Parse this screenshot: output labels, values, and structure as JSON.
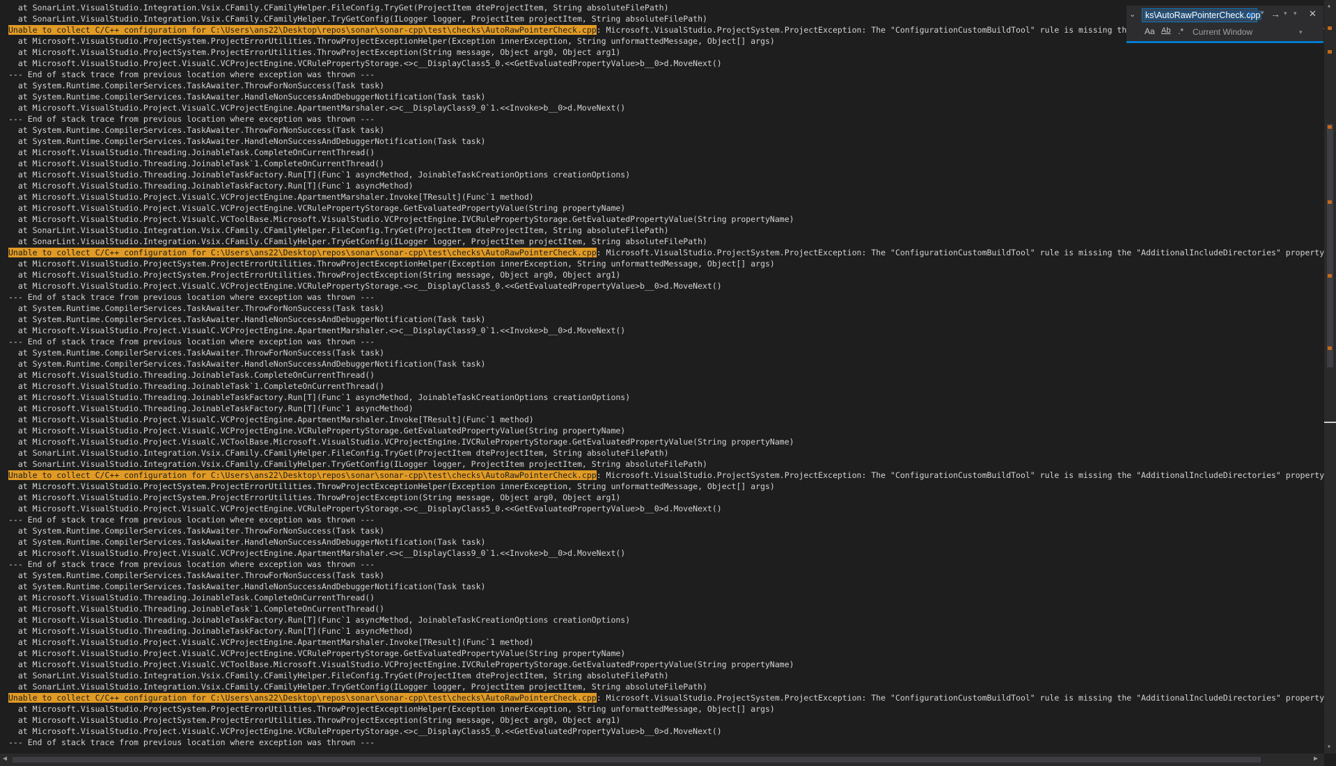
{
  "log": {
    "lines": [
      {
        "text": "  at SonarLint.VisualStudio.Integration.Vsix.CFamily.CFamilyHelper.FileConfig.TryGet(ProjectItem dteProjectItem, String absoluteFilePath)"
      },
      {
        "text": "  at SonarLint.VisualStudio.Integration.Vsix.CFamily.CFamilyHelper.TryGetConfig(ILogger logger, ProjectItem projectItem, String absoluteFilePath)"
      },
      {
        "hl": "Unable to collect C/C++ configuration for C:\\Users\\ans22\\Desktop\\repos\\sonar\\sonar-cpp\\test\\checks\\AutoRawPointerCheck.cpp",
        "text": ": Microsoft.VisualStudio.ProjectSystem.ProjectException: The \"ConfigurationCustomBuildTool\" rule is missing the \"AdditionalIncludeDirectories\" property."
      },
      {
        "text": "  at Microsoft.VisualStudio.ProjectSystem.ProjectErrorUtilities.ThrowProjectExceptionHelper(Exception innerException, String unformattedMessage, Object[] args)"
      },
      {
        "text": "  at Microsoft.VisualStudio.ProjectSystem.ProjectErrorUtilities.ThrowProjectException(String message, Object arg0, Object arg1)"
      },
      {
        "text": "  at Microsoft.VisualStudio.Project.VisualC.VCProjectEngine.VCRulePropertyStorage.<>c__DisplayClass5_0.<<GetEvaluatedPropertyValue>b__0>d.MoveNext()"
      },
      {
        "text": "--- End of stack trace from previous location where exception was thrown ---"
      },
      {
        "text": "  at System.Runtime.CompilerServices.TaskAwaiter.ThrowForNonSuccess(Task task)"
      },
      {
        "text": "  at System.Runtime.CompilerServices.TaskAwaiter.HandleNonSuccessAndDebuggerNotification(Task task)"
      },
      {
        "text": "  at Microsoft.VisualStudio.Project.VisualC.VCProjectEngine.ApartmentMarshaler.<>c__DisplayClass9_0`1.<<Invoke>b__0>d.MoveNext()"
      },
      {
        "text": "--- End of stack trace from previous location where exception was thrown ---"
      },
      {
        "text": "  at System.Runtime.CompilerServices.TaskAwaiter.ThrowForNonSuccess(Task task)"
      },
      {
        "text": "  at System.Runtime.CompilerServices.TaskAwaiter.HandleNonSuccessAndDebuggerNotification(Task task)"
      },
      {
        "text": "  at Microsoft.VisualStudio.Threading.JoinableTask.CompleteOnCurrentThread()"
      },
      {
        "text": "  at Microsoft.VisualStudio.Threading.JoinableTask`1.CompleteOnCurrentThread()"
      },
      {
        "text": "  at Microsoft.VisualStudio.Threading.JoinableTaskFactory.Run[T](Func`1 asyncMethod, JoinableTaskCreationOptions creationOptions)"
      },
      {
        "text": "  at Microsoft.VisualStudio.Threading.JoinableTaskFactory.Run[T](Func`1 asyncMethod)"
      },
      {
        "text": "  at Microsoft.VisualStudio.Project.VisualC.VCProjectEngine.ApartmentMarshaler.Invoke[TResult](Func`1 method)"
      },
      {
        "text": "  at Microsoft.VisualStudio.Project.VisualC.VCProjectEngine.VCRulePropertyStorage.GetEvaluatedPropertyValue(String propertyName)"
      },
      {
        "text": "  at Microsoft.VisualStudio.Project.VisualC.VCToolBase.Microsoft.VisualStudio.VCProjectEngine.IVCRulePropertyStorage.GetEvaluatedPropertyValue(String propertyName)"
      },
      {
        "text": "  at SonarLint.VisualStudio.Integration.Vsix.CFamily.CFamilyHelper.FileConfig.TryGet(ProjectItem dteProjectItem, String absoluteFilePath)"
      },
      {
        "text": "  at SonarLint.VisualStudio.Integration.Vsix.CFamily.CFamilyHelper.TryGetConfig(ILogger logger, ProjectItem projectItem, String absoluteFilePath)"
      },
      {
        "hl": "Unable to collect C/C++ configuration for C:\\Users\\ans22\\Desktop\\repos\\sonar\\sonar-cpp\\test\\checks\\AutoRawPointerCheck.cpp",
        "text": ": Microsoft.VisualStudio.ProjectSystem.ProjectException: The \"ConfigurationCustomBuildTool\" rule is missing the \"AdditionalIncludeDirectories\" property."
      },
      {
        "text": "  at Microsoft.VisualStudio.ProjectSystem.ProjectErrorUtilities.ThrowProjectExceptionHelper(Exception innerException, String unformattedMessage, Object[] args)"
      },
      {
        "text": "  at Microsoft.VisualStudio.ProjectSystem.ProjectErrorUtilities.ThrowProjectException(String message, Object arg0, Object arg1)"
      },
      {
        "text": "  at Microsoft.VisualStudio.Project.VisualC.VCProjectEngine.VCRulePropertyStorage.<>c__DisplayClass5_0.<<GetEvaluatedPropertyValue>b__0>d.MoveNext()"
      },
      {
        "text": "--- End of stack trace from previous location where exception was thrown ---"
      },
      {
        "text": "  at System.Runtime.CompilerServices.TaskAwaiter.ThrowForNonSuccess(Task task)"
      },
      {
        "text": "  at System.Runtime.CompilerServices.TaskAwaiter.HandleNonSuccessAndDebuggerNotification(Task task)"
      },
      {
        "text": "  at Microsoft.VisualStudio.Project.VisualC.VCProjectEngine.ApartmentMarshaler.<>c__DisplayClass9_0`1.<<Invoke>b__0>d.MoveNext()"
      },
      {
        "text": "--- End of stack trace from previous location where exception was thrown ---"
      },
      {
        "text": "  at System.Runtime.CompilerServices.TaskAwaiter.ThrowForNonSuccess(Task task)"
      },
      {
        "text": "  at System.Runtime.CompilerServices.TaskAwaiter.HandleNonSuccessAndDebuggerNotification(Task task)"
      },
      {
        "text": "  at Microsoft.VisualStudio.Threading.JoinableTask.CompleteOnCurrentThread()"
      },
      {
        "text": "  at Microsoft.VisualStudio.Threading.JoinableTask`1.CompleteOnCurrentThread()"
      },
      {
        "text": "  at Microsoft.VisualStudio.Threading.JoinableTaskFactory.Run[T](Func`1 asyncMethod, JoinableTaskCreationOptions creationOptions)"
      },
      {
        "text": "  at Microsoft.VisualStudio.Threading.JoinableTaskFactory.Run[T](Func`1 asyncMethod)"
      },
      {
        "text": "  at Microsoft.VisualStudio.Project.VisualC.VCProjectEngine.ApartmentMarshaler.Invoke[TResult](Func`1 method)"
      },
      {
        "text": "  at Microsoft.VisualStudio.Project.VisualC.VCProjectEngine.VCRulePropertyStorage.GetEvaluatedPropertyValue(String propertyName)"
      },
      {
        "text": "  at Microsoft.VisualStudio.Project.VisualC.VCToolBase.Microsoft.VisualStudio.VCProjectEngine.IVCRulePropertyStorage.GetEvaluatedPropertyValue(String propertyName)"
      },
      {
        "text": "  at SonarLint.VisualStudio.Integration.Vsix.CFamily.CFamilyHelper.FileConfig.TryGet(ProjectItem dteProjectItem, String absoluteFilePath)"
      },
      {
        "text": "  at SonarLint.VisualStudio.Integration.Vsix.CFamily.CFamilyHelper.TryGetConfig(ILogger logger, ProjectItem projectItem, String absoluteFilePath)"
      },
      {
        "hl": "Unable to collect C/C++ configuration for C:\\Users\\ans22\\Desktop\\repos\\sonar\\sonar-cpp\\test\\checks\\AutoRawPointerCheck.cpp",
        "text": ": Microsoft.VisualStudio.ProjectSystem.ProjectException: The \"ConfigurationCustomBuildTool\" rule is missing the \"AdditionalIncludeDirectories\" property."
      },
      {
        "text": "  at Microsoft.VisualStudio.ProjectSystem.ProjectErrorUtilities.ThrowProjectExceptionHelper(Exception innerException, String unformattedMessage, Object[] args)"
      },
      {
        "text": "  at Microsoft.VisualStudio.ProjectSystem.ProjectErrorUtilities.ThrowProjectException(String message, Object arg0, Object arg1)"
      },
      {
        "text": "  at Microsoft.VisualStudio.Project.VisualC.VCProjectEngine.VCRulePropertyStorage.<>c__DisplayClass5_0.<<GetEvaluatedPropertyValue>b__0>d.MoveNext()"
      },
      {
        "text": "--- End of stack trace from previous location where exception was thrown ---"
      },
      {
        "text": "  at System.Runtime.CompilerServices.TaskAwaiter.ThrowForNonSuccess(Task task)"
      },
      {
        "text": "  at System.Runtime.CompilerServices.TaskAwaiter.HandleNonSuccessAndDebuggerNotification(Task task)"
      },
      {
        "text": "  at Microsoft.VisualStudio.Project.VisualC.VCProjectEngine.ApartmentMarshaler.<>c__DisplayClass9_0`1.<<Invoke>b__0>d.MoveNext()"
      },
      {
        "text": "--- End of stack trace from previous location where exception was thrown ---"
      },
      {
        "text": "  at System.Runtime.CompilerServices.TaskAwaiter.ThrowForNonSuccess(Task task)"
      },
      {
        "text": "  at System.Runtime.CompilerServices.TaskAwaiter.HandleNonSuccessAndDebuggerNotification(Task task)"
      },
      {
        "text": "  at Microsoft.VisualStudio.Threading.JoinableTask.CompleteOnCurrentThread()"
      },
      {
        "text": "  at Microsoft.VisualStudio.Threading.JoinableTask`1.CompleteOnCurrentThread()"
      },
      {
        "text": "  at Microsoft.VisualStudio.Threading.JoinableTaskFactory.Run[T](Func`1 asyncMethod, JoinableTaskCreationOptions creationOptions)"
      },
      {
        "text": "  at Microsoft.VisualStudio.Threading.JoinableTaskFactory.Run[T](Func`1 asyncMethod)"
      },
      {
        "text": "  at Microsoft.VisualStudio.Project.VisualC.VCProjectEngine.ApartmentMarshaler.Invoke[TResult](Func`1 method)"
      },
      {
        "text": "  at Microsoft.VisualStudio.Project.VisualC.VCProjectEngine.VCRulePropertyStorage.GetEvaluatedPropertyValue(String propertyName)"
      },
      {
        "text": "  at Microsoft.VisualStudio.Project.VisualC.VCToolBase.Microsoft.VisualStudio.VCProjectEngine.IVCRulePropertyStorage.GetEvaluatedPropertyValue(String propertyName)"
      },
      {
        "text": "  at SonarLint.VisualStudio.Integration.Vsix.CFamily.CFamilyHelper.FileConfig.TryGet(ProjectItem dteProjectItem, String absoluteFilePath)"
      },
      {
        "text": "  at SonarLint.VisualStudio.Integration.Vsix.CFamily.CFamilyHelper.TryGetConfig(ILogger logger, ProjectItem projectItem, String absoluteFilePath)"
      },
      {
        "hl": "Unable to collect C/C++ configuration for C:\\Users\\ans22\\Desktop\\repos\\sonar\\sonar-cpp\\test\\checks\\AutoRawPointerCheck.cpp",
        "text": ": Microsoft.VisualStudio.ProjectSystem.ProjectException: The \"ConfigurationCustomBuildTool\" rule is missing the \"AdditionalIncludeDirectories\" property."
      },
      {
        "text": "  at Microsoft.VisualStudio.ProjectSystem.ProjectErrorUtilities.ThrowProjectExceptionHelper(Exception innerException, String unformattedMessage, Object[] args)"
      },
      {
        "text": "  at Microsoft.VisualStudio.ProjectSystem.ProjectErrorUtilities.ThrowProjectException(String message, Object arg0, Object arg1)"
      },
      {
        "text": "  at Microsoft.VisualStudio.Project.VisualC.VCProjectEngine.VCRulePropertyStorage.<>c__DisplayClass5_0.<<GetEvaluatedPropertyValue>b__0>d.MoveNext()"
      },
      {
        "text": "--- End of stack trace from previous location where exception was thrown ---"
      }
    ]
  },
  "find": {
    "query": "ks\\AutoRawPointerCheck.cpp",
    "scope": "Current Window",
    "match_case_label": "Aa",
    "whole_word_label": "Ab"
  },
  "colors": {
    "background": "#1e1e1e",
    "text": "#d4d4d4",
    "highlight": "#e19b25",
    "accent": "#007acc"
  }
}
